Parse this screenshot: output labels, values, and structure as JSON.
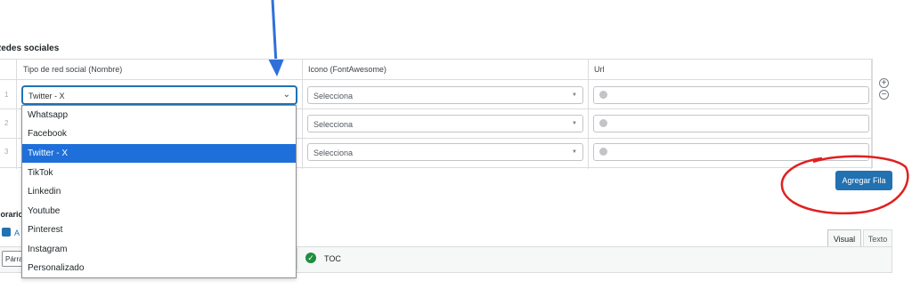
{
  "section": {
    "title": "Redes sociales"
  },
  "table": {
    "headers": {
      "type": "Tipo de red social (Nombre)",
      "icon": "Icono (FontAwesome)",
      "url": "Url"
    },
    "rows": [
      {
        "num": "1",
        "type_value": "Twitter - X",
        "icon_value": "Selecciona"
      },
      {
        "num": "2",
        "icon_value": "Selecciona"
      },
      {
        "num": "3",
        "icon_value": "Selecciona"
      }
    ],
    "add_symbol": "+",
    "remove_symbol": "−",
    "add_row_label": "Agregar Fila"
  },
  "dropdown": {
    "options": [
      "Whatsapp",
      "Facebook",
      "Twitter - X",
      "TikTok",
      "Linkedin",
      "Youtube",
      "Pinterest",
      "Instagram",
      "Personalizado"
    ],
    "selected": "Twitter - X"
  },
  "editor": {
    "section_label": "Horario",
    "add_media_label": "A",
    "format_value": "Párrafo",
    "toc_label": "TOC",
    "tabs": [
      "Visual",
      "Texto"
    ]
  },
  "colors": {
    "accent": "#2271b1",
    "highlight": "#1e6fd9",
    "annotation_arrow": "#2f6fdc",
    "annotation_circle": "#e02020"
  },
  "icons": {
    "arrow": "arrow-down-annotation",
    "circle": "circle-annotation",
    "chevron": "chevron-down-icon",
    "globe": "globe-icon",
    "toc": "check-circle-icon",
    "media": "add-media-icon"
  }
}
